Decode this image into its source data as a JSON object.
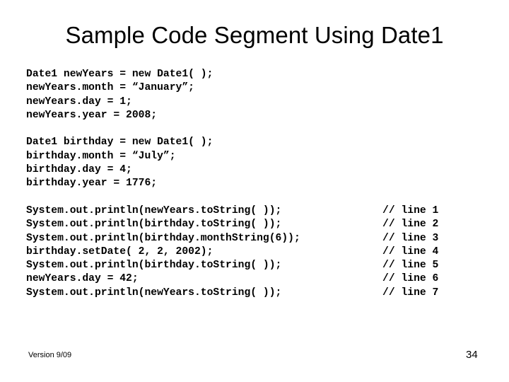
{
  "slide": {
    "title": "Sample Code Segment Using Date1",
    "background_color": "#ffffff",
    "text_color": "#000000"
  },
  "code": {
    "blocks": [
      {
        "id": "declare-new-years",
        "lines": [
          {
            "text": "Date1 newYears = new Date1( );",
            "comment": ""
          },
          {
            "text": "newYears.month = “January”;",
            "comment": ""
          },
          {
            "text": "newYears.day = 1;",
            "comment": ""
          },
          {
            "text": "newYears.year = 2008;",
            "comment": ""
          }
        ]
      },
      {
        "id": "declare-birthday",
        "lines": [
          {
            "text": "Date1 birthday = new Date1( );",
            "comment": ""
          },
          {
            "text": "birthday.month = “July”;",
            "comment": ""
          },
          {
            "text": "birthday.day = 4;",
            "comment": ""
          },
          {
            "text": "birthday.year = 1776;",
            "comment": ""
          }
        ]
      },
      {
        "id": "output-statements",
        "lines": [
          {
            "text": "System.out.println(newYears.toString( ));",
            "comment": "// line 1"
          },
          {
            "text": "System.out.println(birthday.toString( ));",
            "comment": "// line 2"
          },
          {
            "text": "System.out.println(birthday.monthString(6));",
            "comment": "// line 3"
          },
          {
            "text": "birthday.setDate( 2, 2, 2002);",
            "comment": "// line 4"
          },
          {
            "text": "System.out.println(birthday.toString( ));",
            "comment": "// line 5"
          },
          {
            "text": "newYears.day = 42;",
            "comment": "// line 6"
          },
          {
            "text": "System.out.println(newYears.toString( ));",
            "comment": "// line 7"
          }
        ]
      }
    ]
  },
  "footer": {
    "version": "Version 9/09",
    "page_number": "34"
  }
}
